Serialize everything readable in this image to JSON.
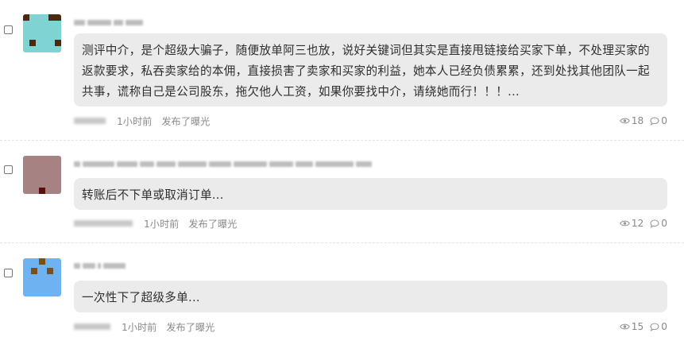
{
  "posts": [
    {
      "text": "测评中介，是个超级大骗子，随便放单阿三也放，说好关键词但其实是直接甩链接给买家下单，不处理买家的返款要求，私吞卖家给的本佣，直接损害了卖家和买家的利益，她本人已经负债累累，还到处找其他团队一起共事，谎称自己是公司股东，拖欠他人工资，如果你要找中介，请绕她而行！！！...",
      "time": "1小时前",
      "action": "发布了曝光",
      "views": "18",
      "comments": "0",
      "avatar_color": "#7fd3d3",
      "avatar_dot_color": "#4a2a12"
    },
    {
      "text": "转账后不下单或取消订单...",
      "time": "1小时前",
      "action": "发布了曝光",
      "views": "12",
      "comments": "0",
      "avatar_color": "#a78282",
      "avatar_dot_color": "#5b0e0e"
    },
    {
      "text": "一次性下了超级多单...",
      "time": "1小时前",
      "action": "发布了曝光",
      "views": "15",
      "comments": "0",
      "avatar_color": "#6fb2f2",
      "avatar_dot_color": "#7a4f1f"
    }
  ]
}
